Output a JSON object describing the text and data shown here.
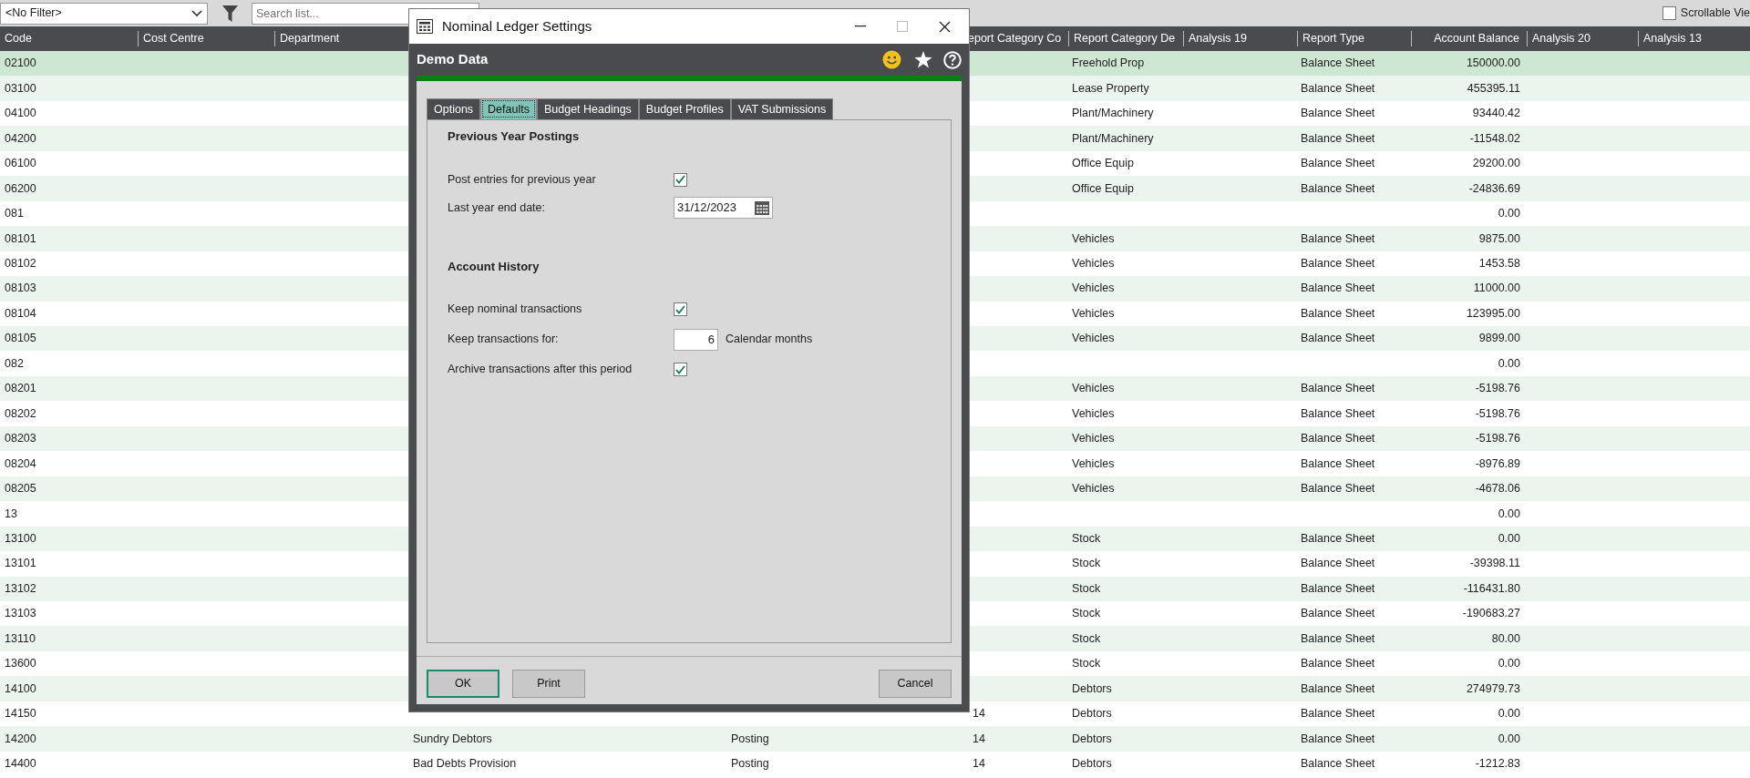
{
  "toolbar": {
    "filter": "<No Filter>",
    "search": {
      "placeholder": "Search list..."
    },
    "scrollable_view": {
      "label": "Scrollable Vie",
      "checked": false
    }
  },
  "table": {
    "columns": [
      {
        "label": "Code"
      },
      {
        "label": "Cost Centre"
      },
      {
        "label": "Department"
      },
      {
        "label": "eport Category Co"
      },
      {
        "label": "Report Category De"
      },
      {
        "label": "Analysis 19"
      },
      {
        "label": "Report Type"
      },
      {
        "label": "Account Balance"
      },
      {
        "label": "Analysis 20"
      },
      {
        "label": "Analysis 13"
      }
    ],
    "rows": [
      {
        "code": "02100",
        "category": "Freehold Prop",
        "report_type": "Balance Sheet",
        "balance": "150000.00",
        "selected": true
      },
      {
        "code": "03100",
        "category": "Lease Property",
        "report_type": "Balance Sheet",
        "balance": "455395.11",
        "selected": false
      },
      {
        "code": "04100",
        "category": "Plant/Machinery",
        "report_type": "Balance Sheet",
        "balance": "93440.42",
        "selected": false
      },
      {
        "code": "04200",
        "category": "Plant/Machinery",
        "report_type": "Balance Sheet",
        "balance": "-11548.02",
        "selected": false
      },
      {
        "code": "06100",
        "category": "Office Equip",
        "report_type": "Balance Sheet",
        "balance": "29200.00",
        "selected": false
      },
      {
        "code": "06200",
        "category": "Office Equip",
        "report_type": "Balance Sheet",
        "balance": "-24836.69",
        "selected": false
      },
      {
        "code": "081",
        "balance": "0.00",
        "selected": false
      },
      {
        "code": "08101",
        "category": "Vehicles",
        "report_type": "Balance Sheet",
        "balance": "9875.00",
        "selected": false
      },
      {
        "code": "08102",
        "category": "Vehicles",
        "report_type": "Balance Sheet",
        "balance": "1453.58",
        "selected": false
      },
      {
        "code": "08103",
        "category": "Vehicles",
        "report_type": "Balance Sheet",
        "balance": "11000.00",
        "selected": false
      },
      {
        "code": "08104",
        "category": "Vehicles",
        "report_type": "Balance Sheet",
        "balance": "123995.00",
        "selected": false
      },
      {
        "code": "08105",
        "category": "Vehicles",
        "report_type": "Balance Sheet",
        "balance": "9899.00",
        "selected": false
      },
      {
        "code": "082",
        "balance": "0.00",
        "selected": false
      },
      {
        "code": "08201",
        "category": "Vehicles",
        "report_type": "Balance Sheet",
        "balance": "-5198.76",
        "selected": false
      },
      {
        "code": "08202",
        "category": "Vehicles",
        "report_type": "Balance Sheet",
        "balance": "-5198.76",
        "selected": false
      },
      {
        "code": "08203",
        "category": "Vehicles",
        "report_type": "Balance Sheet",
        "balance": "-5198.76",
        "selected": false
      },
      {
        "code": "08204",
        "category": "Vehicles",
        "report_type": "Balance Sheet",
        "balance": "-8976.89",
        "selected": false
      },
      {
        "code": "08205",
        "category": "Vehicles",
        "report_type": "Balance Sheet",
        "balance": "-4678.06",
        "selected": false
      },
      {
        "code": "13",
        "balance": "0.00",
        "selected": false
      },
      {
        "code": "13100",
        "category": "Stock",
        "report_type": "Balance Sheet",
        "balance": "0.00",
        "selected": false
      },
      {
        "code": "13101",
        "category": "Stock",
        "report_type": "Balance Sheet",
        "balance": "-39398.11",
        "selected": false
      },
      {
        "code": "13102",
        "category": "Stock",
        "report_type": "Balance Sheet",
        "balance": "-116431.80",
        "selected": false
      },
      {
        "code": "13103",
        "category": "Stock",
        "report_type": "Balance Sheet",
        "balance": "-190683.27",
        "selected": false
      },
      {
        "code": "13110",
        "category": "Stock",
        "report_type": "Balance Sheet",
        "balance": "80.00",
        "selected": false
      },
      {
        "code": "13600",
        "category": "Stock",
        "report_type": "Balance Sheet",
        "balance": "0.00",
        "selected": false
      },
      {
        "code": "14100",
        "category": "Debtors",
        "report_type": "Balance Sheet",
        "balance": "274979.73",
        "selected": false
      },
      {
        "code": "14150",
        "category_code": "14",
        "category": "Debtors",
        "report_type": "Balance Sheet",
        "balance": "0.00",
        "selected": false
      },
      {
        "code": "14200",
        "name": "Sundry Debtors",
        "type": "Posting",
        "category_code": "14",
        "category": "Debtors",
        "report_type": "Balance Sheet",
        "balance": "0.00",
        "selected": false
      },
      {
        "code": "14400",
        "name": "Bad Debts Provision",
        "type": "Posting",
        "category_code": "14",
        "category": "Debtors",
        "report_type": "Balance Sheet",
        "balance": "-1212.83",
        "selected": false
      }
    ]
  },
  "dialog": {
    "title": "Nominal Ledger Settings",
    "company": "Demo Data",
    "tabs": [
      {
        "label": "Options",
        "selected": false
      },
      {
        "label": "Defaults",
        "selected": true
      },
      {
        "label": "Budget Headings",
        "selected": false
      },
      {
        "label": "Budget Profiles",
        "selected": false
      },
      {
        "label": "VAT Submissions",
        "selected": false
      }
    ],
    "sections": [
      {
        "heading": "Previous Year Postings",
        "fields": [
          {
            "kind": "checkbox",
            "label": "Post entries for previous year",
            "checked": true
          },
          {
            "kind": "date",
            "label": "Last year end date:",
            "value": "31/12/2023"
          }
        ]
      },
      {
        "heading": "Account History",
        "fields": [
          {
            "kind": "checkbox",
            "label": "Keep nominal transactions",
            "checked": true
          },
          {
            "kind": "number",
            "label": "Keep transactions for:",
            "value": "6",
            "unit": "Calendar months"
          },
          {
            "kind": "checkbox",
            "label": "Archive transactions after this period",
            "checked": true
          }
        ]
      }
    ],
    "buttons": [
      {
        "label": "OK",
        "default": true
      },
      {
        "label": "Print",
        "default": false
      },
      {
        "label": "Cancel",
        "default": false
      }
    ]
  }
}
